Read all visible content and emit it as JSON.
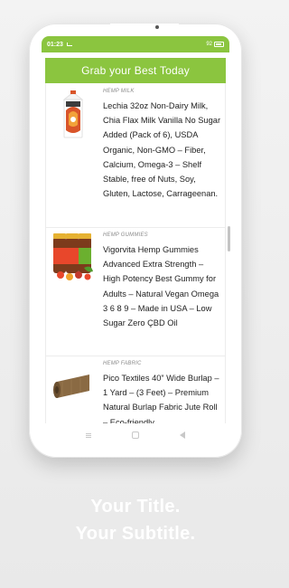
{
  "status_bar": {
    "time": "01:23",
    "battery": "92"
  },
  "header": {
    "title": "Grab your Best Today"
  },
  "products": [
    {
      "category": "HEMP MILK",
      "title": "Lechia 32oz Non-Dairy Milk, Chia Flax Milk Vanilla No Sugar Added (Pack of 6), USDA Organic, Non-GMO – Fiber, Calcium, Omega-3 – Shelf Stable, free of Nuts, Soy, Gluten, Lactose, Carrageenan."
    },
    {
      "category": "HEMP GUMMIES",
      "title": "Vigorvita Hemp Gummies Advanced Extra Strength – High Potency Best Gummy for Adults – Natural Vegan Omega 3 6 8 9 – Made in USA – Low Sugar Zero ÇBD Oil"
    },
    {
      "category": "HEMP FABRIC",
      "title": "Pico Textiles 40” Wide Burlap – 1 Yard – (3 Feet) – Premium Natural Burlap Fabric Jute Roll – Eco-friendly"
    }
  ],
  "promo": {
    "title": "Your Title.",
    "subtitle": "Your Subtitle."
  },
  "colors": {
    "accent": "#8bc53f",
    "promo_text": "#ffffff"
  }
}
